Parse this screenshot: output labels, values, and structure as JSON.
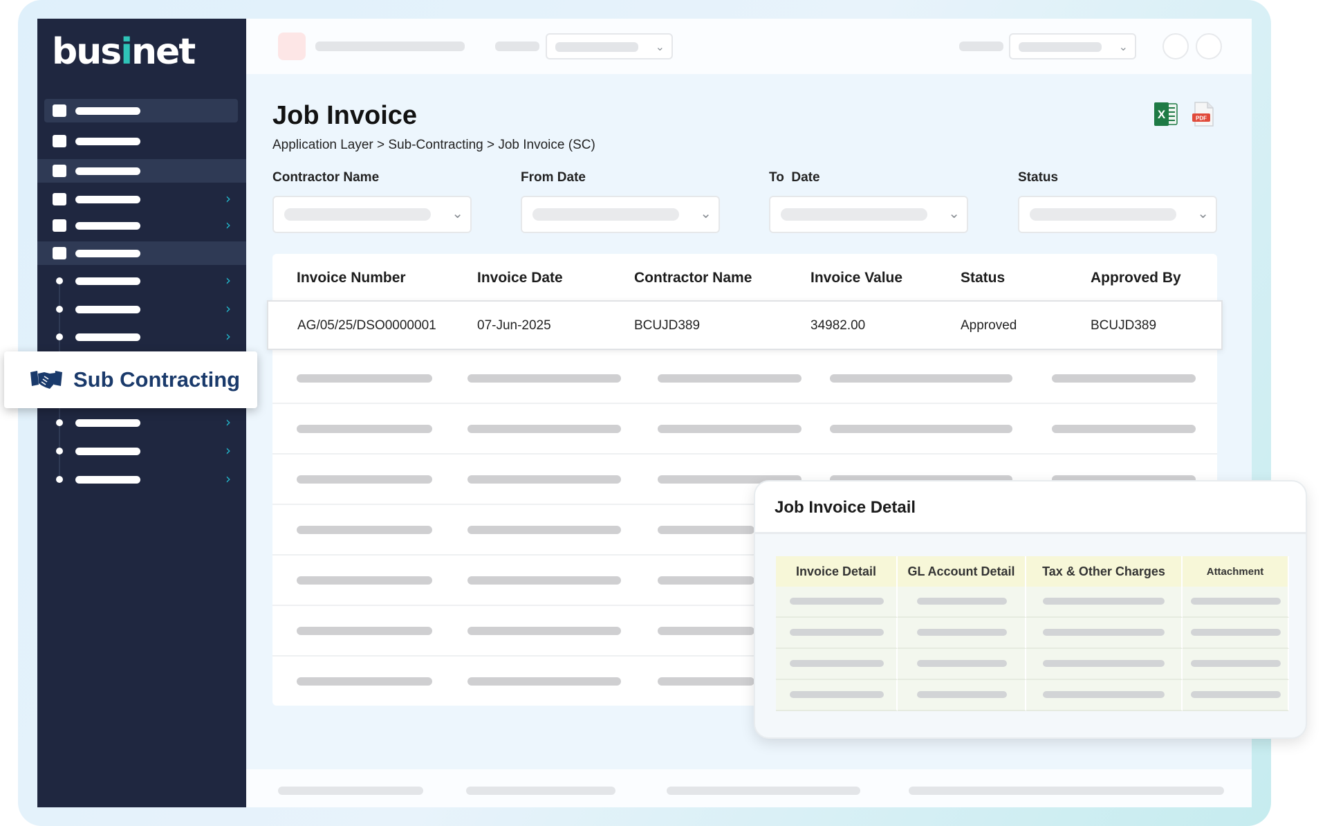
{
  "app": {
    "logo_text_a": "bus",
    "logo_text_b": "i",
    "logo_text_c": "net"
  },
  "sidebar": {
    "highlight_label": "Sub Contracting",
    "highlight_icon": "handshake-icon"
  },
  "page": {
    "title": "Job Invoice",
    "breadcrumb": "Application Layer > Sub-Contracting > Job Invoice (SC)",
    "export_icons": [
      "excel-icon",
      "pdf-icon"
    ]
  },
  "filters": {
    "contractor_label": "Contractor Name",
    "from_label": "From Date",
    "to_label": "To  Date",
    "status_label": "Status"
  },
  "table": {
    "columns": [
      "Invoice Number",
      "Invoice Date",
      "Contractor Name",
      "Invoice Value",
      "Status",
      "Approved By"
    ],
    "rows": [
      [
        "AG/05/25/DSO0000001",
        "07-Jun-2025",
        "BCUJD389",
        "34982.00",
        "Approved",
        "BCUJD389"
      ]
    ]
  },
  "detail": {
    "title": "Job Invoice Detail",
    "tabs": [
      "Invoice Detail",
      "GL Account Detail",
      "Tax & Other Charges",
      "Attachment"
    ]
  },
  "colors": {
    "sidebar": "#1f2740",
    "accent": "#2fc4b8",
    "callout_text": "#1a3a6b",
    "excel": "#1e7a45",
    "pdf": "#e04a3a"
  }
}
